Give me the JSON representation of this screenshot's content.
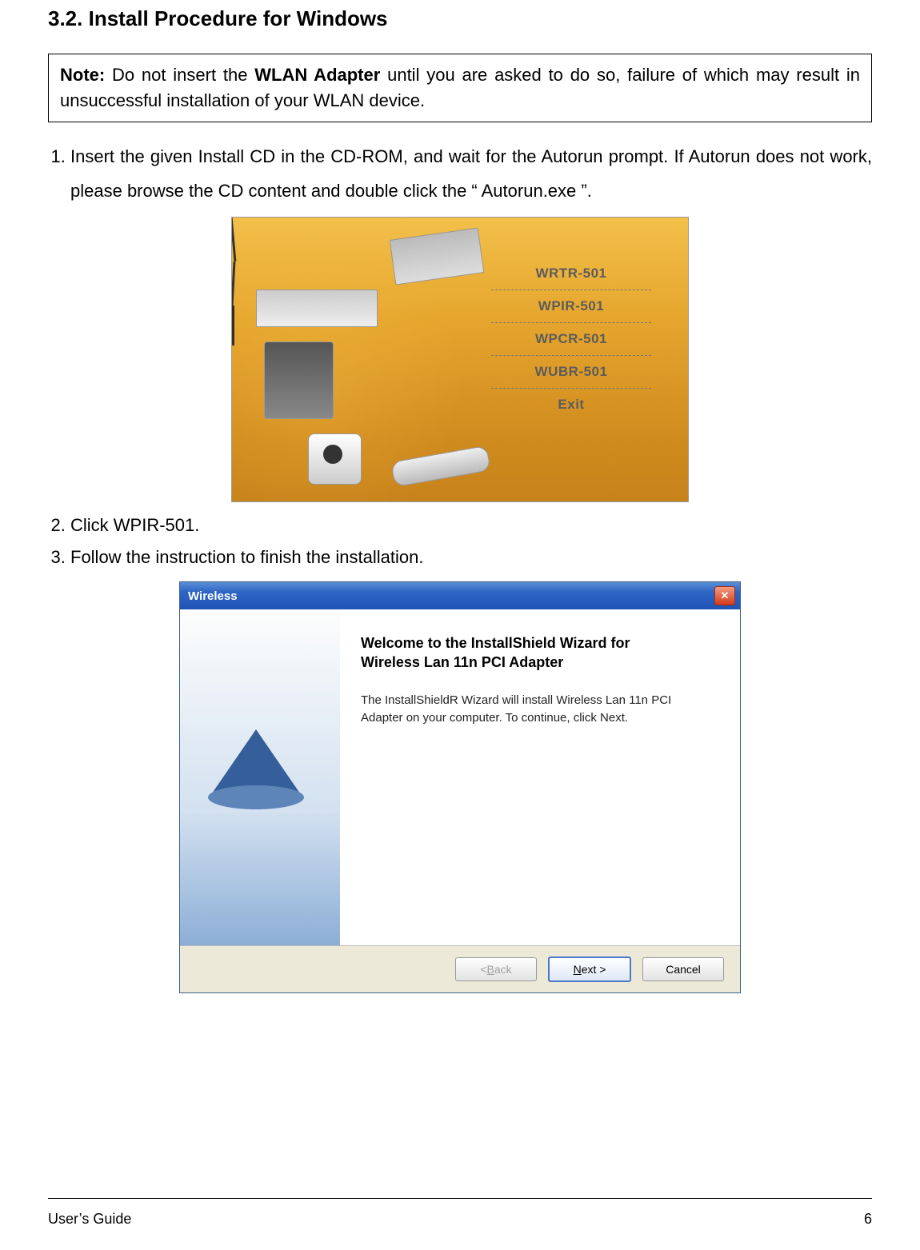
{
  "section_heading": "3.2. Install Procedure for Windows",
  "note": {
    "label": "Note:",
    "pre": " Do not insert the ",
    "bold": "WLAN Adapter",
    "post": " until you are asked to do so, failure of which may result in unsuccessful installation of your WLAN device."
  },
  "steps": {
    "s1": "Insert the given Install CD in the CD-ROM, and wait for the Autorun prompt. If Autorun does not work, please browse the CD content and double click the “ Autorun.exe ”.",
    "s2": "Click WPIR-501.",
    "s3": "Follow the instruction to finish the installation."
  },
  "autorun_menu": {
    "items": [
      "WRTR-501",
      "WPIR-501",
      "WPCR-501",
      "WUBR-501",
      "Exit"
    ]
  },
  "wizard": {
    "title": "Wireless",
    "heading_line1": "Welcome to the InstallShield Wizard for",
    "heading_line2": "Wireless Lan 11n PCI Adapter",
    "body": "The InstallShieldR Wizard will install Wireless Lan 11n PCI Adapter on your computer.  To continue, click Next.",
    "buttons": {
      "back_prefix": "< ",
      "back_letter": "B",
      "back_rest": "ack",
      "next_letter": "N",
      "next_rest": "ext >",
      "cancel": "Cancel"
    }
  },
  "footer": {
    "left": "User’s Guide",
    "right": "6"
  }
}
